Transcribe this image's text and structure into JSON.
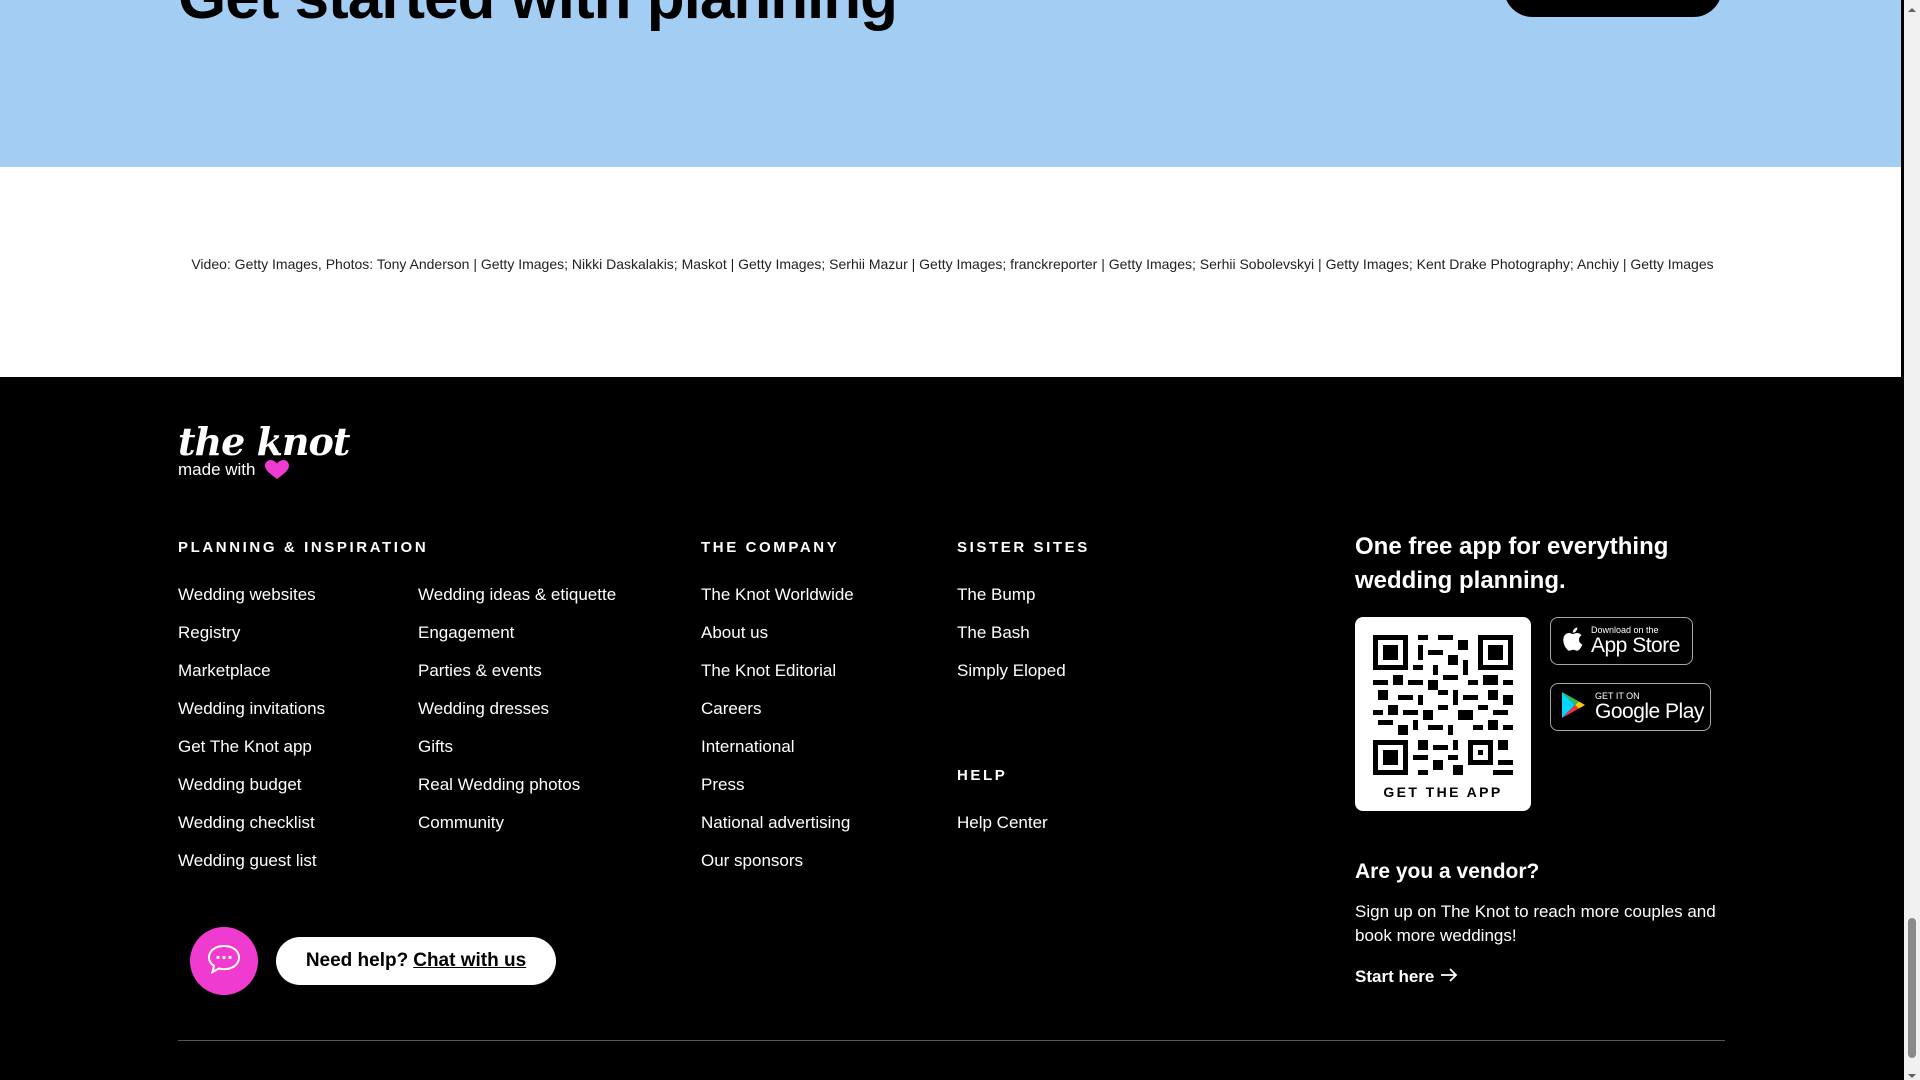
{
  "hero": {
    "heading": "Get started with planning"
  },
  "credits": {
    "text": "Video: Getty Images, Photos: Tony Anderson | Getty Images; Nikki Daskalakis; Maskot | Getty Images; Serhii Mazur | Getty Images; franckreporter | Getty Images; Serhii Sobolevskyi | Getty Images; Kent Drake Photography; Anchiy | Getty Images"
  },
  "footer": {
    "logo": "the knot",
    "made_with": "made with",
    "heart_color": "#ef3bd0",
    "planning": {
      "heading": "PLANNING & INSPIRATION",
      "col1": [
        "Wedding websites",
        "Registry",
        "Marketplace",
        "Wedding invitations",
        "Get The Knot app",
        "Wedding budget",
        "Wedding checklist",
        "Wedding guest list"
      ],
      "col2": [
        "Wedding ideas & etiquette",
        "Engagement",
        "Parties & events",
        "Wedding dresses",
        "Gifts",
        "Real Wedding photos",
        "Community"
      ]
    },
    "company": {
      "heading": "THE COMPANY",
      "items": [
        "The Knot Worldwide",
        "About us",
        "The Knot Editorial",
        "Careers",
        "International",
        "Press",
        "National advertising",
        "Our sponsors"
      ]
    },
    "sister": {
      "heading": "SISTER SITES",
      "items": [
        "The Bump",
        "The Bash",
        "Simply Eloped"
      ]
    },
    "help": {
      "heading": "HELP",
      "items": [
        "Help Center"
      ]
    },
    "app": {
      "title": "One free app for everything wedding planning.",
      "qr_label": "GET THE APP",
      "app_store_small": "Download on the",
      "app_store_big": "App Store",
      "google_small": "GET IT ON",
      "google_big": "Google Play"
    },
    "vendor": {
      "title": "Are you a vendor?",
      "text": "Sign up on The Knot to reach more couples and book more weddings!",
      "link": "Start here"
    },
    "chat": {
      "prefix": "Need help?",
      "link": "Chat with us",
      "bubble_color": "#ef3bd0"
    }
  }
}
